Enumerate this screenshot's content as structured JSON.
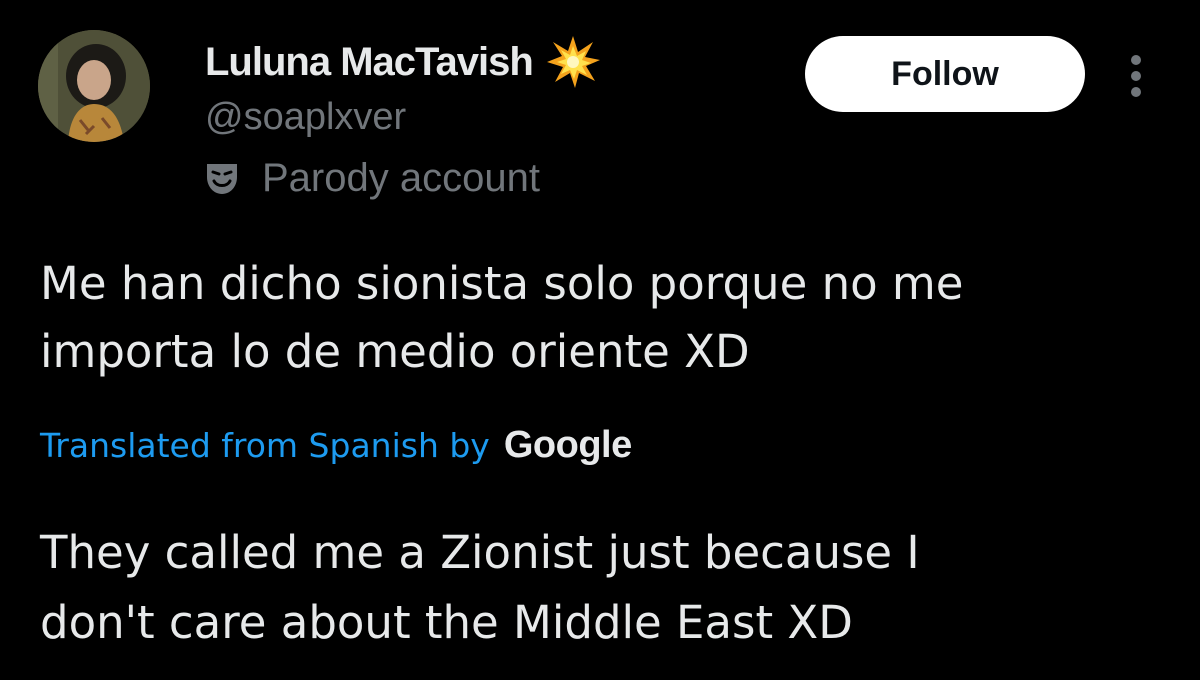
{
  "author": {
    "display_name": "Luluna MacTavish",
    "name_emoji": "collision-icon",
    "handle": "@soaplxver",
    "label": "Parody account",
    "label_icon": "theater-mask-icon"
  },
  "actions": {
    "follow_label": "Follow",
    "more_icon": "more-vertical-icon"
  },
  "post": {
    "text_line1": "Me han dicho sionista solo porque no me",
    "text_line2": "importa lo de medio oriente XD",
    "translated_from": "Translated from Spanish by",
    "translator": "Google",
    "translation_line1": "They called me a Zionist just because I",
    "translation_line2": "don't care about the Middle East XD"
  },
  "colors": {
    "background": "#000000",
    "text_primary": "#e7e9ea",
    "text_secondary": "#71767b",
    "link": "#1d9bf0",
    "button_bg": "#ffffff",
    "button_text": "#0f1419"
  }
}
